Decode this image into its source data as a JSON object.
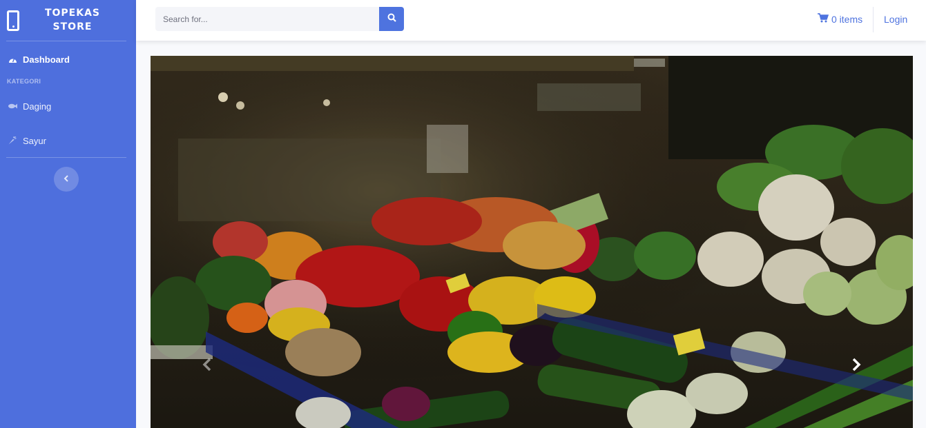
{
  "brand": {
    "line1": "TOPEKAS",
    "line2": "STORE"
  },
  "sidebar": {
    "dashboard_label": "Dashboard",
    "category_heading": "KATEGORI",
    "items": [
      {
        "label": "Daging",
        "icon": "fish-icon"
      },
      {
        "label": "Sayur",
        "icon": "carrot-icon"
      }
    ],
    "toggle_icon": "chevron-left-icon"
  },
  "search": {
    "placeholder": "Search for...",
    "value": ""
  },
  "cart": {
    "label": "0 items",
    "icon": "shopping-cart-icon"
  },
  "login_label": "Login",
  "colors": {
    "sidebar": "#4e6fdd",
    "accent": "#4e73df",
    "background": "#f8f9fc"
  },
  "carousel": {
    "prev_icon": "chevron-left-icon",
    "next_icon": "chevron-right-icon"
  }
}
